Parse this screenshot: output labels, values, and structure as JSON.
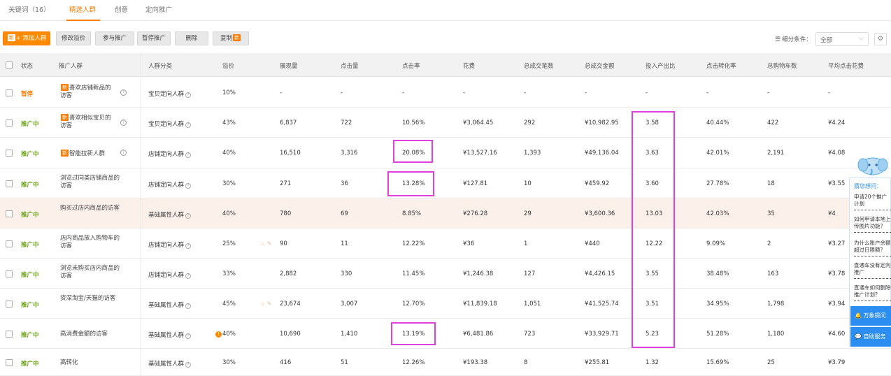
{
  "tabs": [
    "关键词（16）",
    "精选人群",
    "创意",
    "定向推广"
  ],
  "toolbar": {
    "add_label": "+ 添加人群",
    "new_badge": "新",
    "modify_price": "修改溢价",
    "join_promo": "参与推广",
    "pause": "暂停推广",
    "delete": "删除",
    "copy": "复制",
    "filter_label": "细分条件：",
    "filter_value": "全部"
  },
  "columns": [
    "状态",
    "推广人群",
    "人群分类",
    "溢价",
    "展现量",
    "点击量",
    "点击率",
    "花费",
    "总成交笔数",
    "总成交金额",
    "投入产出比",
    "点击转化率",
    "总购物车数",
    "平均点击花费"
  ],
  "rows": [
    {
      "status": "暂停",
      "name": "喜欢店铺新品的访客",
      "is_new": true,
      "category": "宝贝定向人群",
      "premium": "10%",
      "impressions": "-",
      "clicks": "-",
      "ctr": "-",
      "cost": "-",
      "orders": "-",
      "gmv": "-",
      "roi": "-",
      "cvr": "-",
      "carts": "-",
      "cpc": "-"
    },
    {
      "status": "推广中",
      "name": "喜欢相似宝贝的访客",
      "is_new": true,
      "category": "宝贝定向人群",
      "premium": "43%",
      "impressions": "6,837",
      "clicks": "722",
      "ctr": "10.56%",
      "cost": "¥3,064.45",
      "orders": "292",
      "gmv": "¥10,982.95",
      "roi": "3.58",
      "cvr": "40.44%",
      "carts": "422",
      "cpc": "¥4.24"
    },
    {
      "status": "推广中",
      "name": "智能拉新人群",
      "is_new": true,
      "category": "店铺定向人群",
      "premium": "40%",
      "impressions": "16,510",
      "clicks": "3,316",
      "ctr": "20.08%",
      "cost": "¥13,527.16",
      "orders": "1,393",
      "gmv": "¥49,136.04",
      "roi": "3.63",
      "cvr": "42.01%",
      "carts": "2,191",
      "cpc": "¥4.08"
    },
    {
      "status": "推广中",
      "name": "浏览过同类店铺商品的访客",
      "is_new": false,
      "category": "店铺定向人群",
      "premium": "30%",
      "impressions": "271",
      "clicks": "36",
      "ctr": "13.28%",
      "cost": "¥127.81",
      "orders": "10",
      "gmv": "¥459.92",
      "roi": "3.60",
      "cvr": "27.78%",
      "carts": "18",
      "cpc": "¥3.55"
    },
    {
      "status": "推广中",
      "name": "购买过店内商品的访客",
      "is_new": false,
      "category": "基础属性人群",
      "premium": "40%",
      "impressions": "780",
      "clicks": "69",
      "ctr": "8.85%",
      "cost": "¥276.28",
      "orders": "29",
      "gmv": "¥3,600.36",
      "roi": "13.03",
      "cvr": "42.03%",
      "carts": "35",
      "cpc": "¥4"
    },
    {
      "status": "推广中",
      "name": "店内商品放入购物车的访客",
      "is_new": false,
      "category": "店铺定向人群",
      "premium": "25%",
      "impressions": "90",
      "clicks": "11",
      "ctr": "12.22%",
      "cost": "¥36",
      "orders": "1",
      "gmv": "¥440",
      "roi": "12.22",
      "cvr": "9.09%",
      "carts": "2",
      "cpc": "¥3.27"
    },
    {
      "status": "推广中",
      "name": "浏览未购买店内商品的访客",
      "is_new": false,
      "category": "店铺定向人群",
      "premium": "33%",
      "impressions": "2,882",
      "clicks": "330",
      "ctr": "11.45%",
      "cost": "¥1,246.38",
      "orders": "127",
      "gmv": "¥4,426.15",
      "roi": "3.55",
      "cvr": "38.48%",
      "carts": "163",
      "cpc": "¥3.78"
    },
    {
      "status": "推广中",
      "name": "资深淘宝/天猫的访客",
      "is_new": false,
      "category": "基础属性人群",
      "premium": "45%",
      "impressions": "23,674",
      "clicks": "3,007",
      "ctr": "12.70%",
      "cost": "¥11,839.18",
      "orders": "1,051",
      "gmv": "¥41,525.74",
      "roi": "3.51",
      "cvr": "34.95%",
      "carts": "1,798",
      "cpc": "¥3.94"
    },
    {
      "status": "推广中",
      "name": "高消费金额的访客",
      "is_new": false,
      "category": "基础属性人群",
      "premium": "40%",
      "impressions": "10,690",
      "clicks": "1,410",
      "ctr": "13.19%",
      "cost": "¥6,481.86",
      "orders": "723",
      "gmv": "¥33,929.71",
      "roi": "5.23",
      "cvr": "51.28%",
      "carts": "1,180",
      "cpc": "¥4.60"
    },
    {
      "status": "推广中",
      "name": "高转化",
      "is_new": false,
      "category": "基础属性人群",
      "premium": "30%",
      "impressions": "416",
      "clicks": "51",
      "ctr": "12.26%",
      "cost": "¥193.38",
      "orders": "8",
      "gmv": "¥255.81",
      "roi": "1.32",
      "cvr": "15.69%",
      "carts": "25",
      "cpc": "¥3.79"
    }
  ],
  "side_panel": {
    "title": "猜您想问：",
    "questions": [
      "申请20个推广计划",
      "如何申请本地上传图片功能？",
      "为什么账户余额超过日限额？",
      "直通车没有定向推广",
      "直通车如何删除推广计划？"
    ],
    "btn_ai": "万象提问",
    "btn_self": "自助服务"
  },
  "icons": {
    "question": "?",
    "settings": "gear-icon",
    "chevron": "chevron-down-icon"
  }
}
